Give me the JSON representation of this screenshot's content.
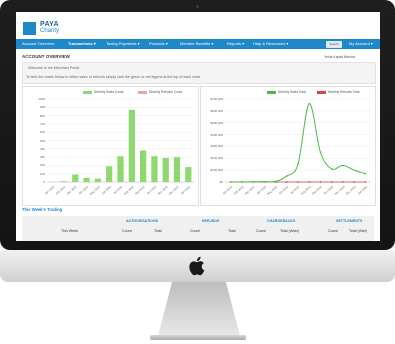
{
  "brand": {
    "name": "PAYA",
    "sub": "Charity"
  },
  "nav": {
    "items": [
      {
        "label": "Account Overview",
        "active": false
      },
      {
        "label": "Transactions ▾",
        "active": true
      },
      {
        "label": "Taxing Payments ▾",
        "active": false
      },
      {
        "label": "Products ▾",
        "active": false
      },
      {
        "label": "Member Benefits ▾",
        "active": false
      },
      {
        "label": "Reports ▾",
        "active": false
      },
      {
        "label": "Help & Resources ▾",
        "active": false
      }
    ],
    "search_label": "Search",
    "account_label": "My Account ▾"
  },
  "page": {
    "title": "ACCOUNT OVERVIEW",
    "user": "Yehia Kapati Mission"
  },
  "welcome": {
    "heading": "Welcome to the Merchant Portal",
    "text": "To limit the charts below to either sales or refunds simply click the green or red legend at the top of each chart."
  },
  "colors": {
    "nav": "#1f88c9",
    "green": "#4cbb4c",
    "red": "#d84545",
    "pink": "#eda3a3",
    "barGreen": "#8ed96e"
  },
  "chart_data": [
    {
      "type": "bar",
      "categories": [
        "Jan 2015",
        "Feb 2015",
        "Mar 2015",
        "Apr 2015",
        "May 2015",
        "Jun 2015",
        "Jul 2015",
        "Aug 2015",
        "Sep 2015",
        "Oct 2015",
        "Nov 2015",
        "Dec 2015",
        "Jan 2016"
      ],
      "series": [
        {
          "name": "Monthly Sales Count",
          "values": [
            0,
            10,
            90,
            50,
            40,
            190,
            310,
            870,
            380,
            310,
            290,
            300,
            180
          ]
        },
        {
          "name": "Monthly Refunds Count",
          "values": [
            0,
            0,
            0,
            0,
            0,
            0,
            0,
            0,
            0,
            0,
            0,
            0,
            0
          ]
        }
      ],
      "yticks": [
        "1000",
        "900",
        "800",
        "700",
        "600",
        "500",
        "400",
        "300",
        "200",
        "100",
        "0"
      ],
      "ylim": [
        0,
        1000
      ],
      "grid": true,
      "legend": "top"
    },
    {
      "type": "line",
      "categories": [
        "Jan 2015",
        "Feb 2015",
        "Mar 2015",
        "Apr 2015",
        "May 2015",
        "Jun 2015",
        "Jul 2015",
        "Aug 2015",
        "Sep 2015",
        "Oct 2015",
        "Nov 2015",
        "Dec 2015",
        "Jan 2016"
      ],
      "series": [
        {
          "name": "Monthly Sales Total",
          "values": [
            0,
            1000,
            2000,
            3000,
            5000,
            50000,
            150000,
            660000,
            250000,
            110000,
            140000,
            100000,
            70000
          ]
        },
        {
          "name": "Monthly Refunds Total",
          "values": [
            0,
            0,
            0,
            0,
            0,
            0,
            0,
            0,
            0,
            0,
            0,
            0,
            0
          ]
        }
      ],
      "yticks": [
        "$700,000",
        "$600,000",
        "$500,000",
        "$400,000",
        "$300,000",
        "$200,000",
        "$100,000",
        "$0"
      ],
      "ylim": [
        0,
        700000
      ],
      "grid": true,
      "legend": "top"
    }
  ],
  "trading": {
    "title": "This Week's Trading",
    "groups": [
      "AUTHORISATIONS",
      "REFUNDS",
      "CHARGEBACKS",
      "SETTLEMENTS"
    ],
    "row_label": "This Week",
    "cols": {
      "auth": [
        "Count",
        "Total"
      ],
      "refunds": [
        "Count",
        "Total"
      ],
      "chargebacks": [
        "Count",
        "Total (rMax)"
      ],
      "settlements": [
        "Count",
        "Total (rNet)"
      ]
    }
  }
}
